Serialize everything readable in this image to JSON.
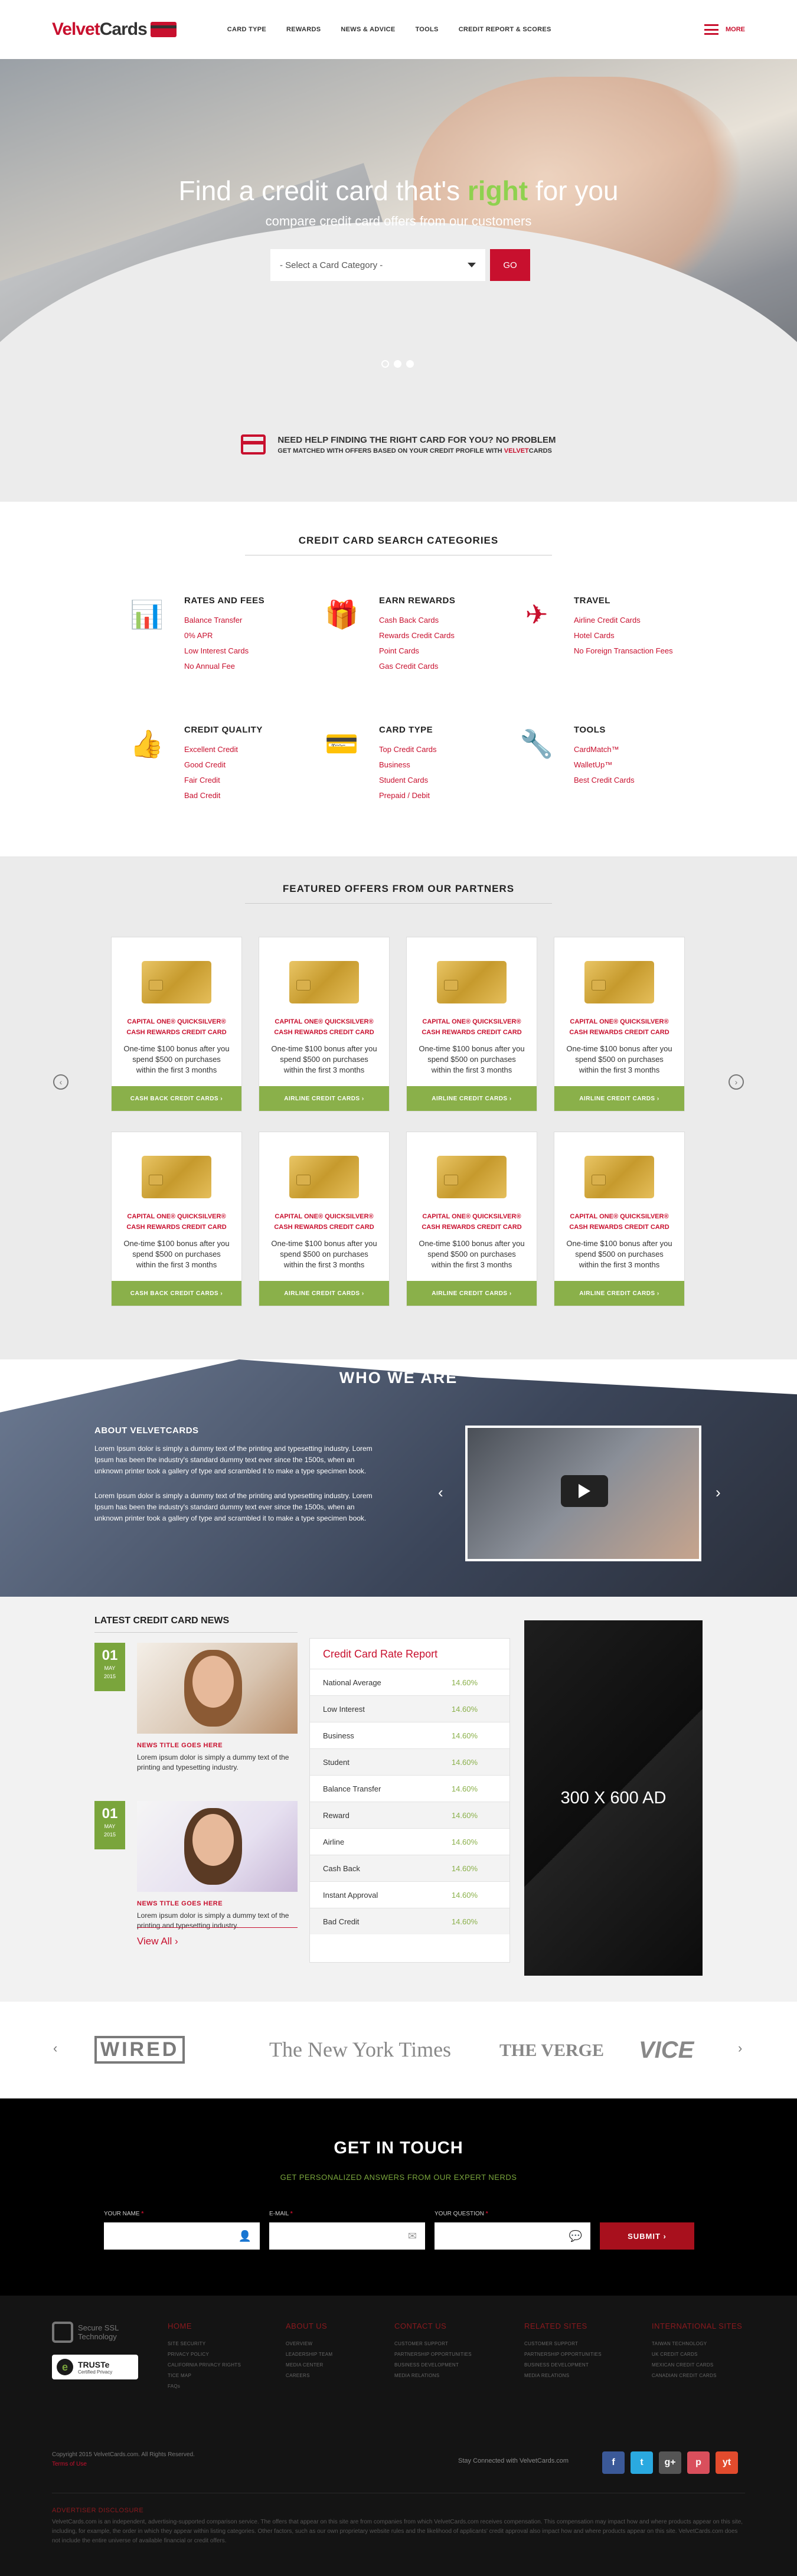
{
  "header": {
    "logo_part1": "Velvet",
    "logo_part2": "Cards",
    "nav": [
      "CARD TYPE",
      "REWARDS",
      "NEWS & ADVICE",
      "TOOLS",
      "CREDIT REPORT & SCORES"
    ],
    "more_label": "MORE"
  },
  "hero": {
    "title_before": "Find a credit card that's ",
    "title_highlight": "right",
    "title_after": " for you",
    "subtitle": "compare credit card offers from our customers",
    "select_placeholder": "- Select a Card Category -",
    "go_label": "GO"
  },
  "help": {
    "line1": "NEED HELP FINDING THE RIGHT CARD FOR YOU? NO PROBLEM",
    "line2": "GET MATCHED WITH OFFERS BASED ON YOUR CREDIT PROFILE WITH ",
    "brand_part1": "VELVET",
    "brand_part2": "CARDS"
  },
  "categories": {
    "title": "CREDIT CARD SEARCH CATEGORIES",
    "items": [
      {
        "icon": "bar-chart-icon",
        "title": "RATES AND FEES",
        "links": [
          "Balance Transfer",
          "0% APR",
          "Low Interest Cards",
          "No Annual Fee"
        ]
      },
      {
        "icon": "gift-icon",
        "title": "EARN REWARDS",
        "links": [
          "Cash Back Cards",
          "Rewards Credit Cards",
          "Point Cards",
          "Gas Credit Cards"
        ]
      },
      {
        "icon": "airplane-icon",
        "title": "TRAVEL",
        "links": [
          "Airline Credit Cards",
          "Hotel Cards",
          "No Foreign Transaction Fees"
        ]
      },
      {
        "icon": "thumbs-up-icon",
        "title": "CREDIT QUALITY",
        "links": [
          "Excellent Credit",
          "Good Credit",
          "Fair Credit",
          "Bad Credit"
        ]
      },
      {
        "icon": "credit-card-icon",
        "title": "CARD TYPE",
        "links": [
          "Top Credit Cards",
          "Business",
          "Student Cards",
          "Prepaid / Debit"
        ]
      },
      {
        "icon": "wrench-icon",
        "title": "TOOLS",
        "links": [
          "CardMatch™",
          "WalletUp™",
          "Best Credit Cards"
        ]
      }
    ]
  },
  "offers": {
    "title": "FEATURED OFFERS FROM OUR PARTNERS",
    "items": [
      {
        "name": "CAPITAL ONE® QUICKSILVER® CASH REWARDS CREDIT CARD",
        "desc": "One-time $100 bonus after you spend $500 on purchases within the first 3 months",
        "button": "CASH BACK CREDIT CARDS"
      },
      {
        "name": "CAPITAL ONE® QUICKSILVER® CASH REWARDS CREDIT CARD",
        "desc": "One-time $100 bonus after you spend $500 on purchases within the first 3 months",
        "button": "AIRLINE CREDIT CARDS"
      },
      {
        "name": "CAPITAL ONE® QUICKSILVER® CASH REWARDS CREDIT CARD",
        "desc": "One-time $100 bonus after you spend $500 on purchases within the first 3 months",
        "button": "AIRLINE CREDIT CARDS"
      },
      {
        "name": "CAPITAL ONE® QUICKSILVER® CASH REWARDS CREDIT CARD",
        "desc": "One-time $100 bonus after you spend $500 on purchases within the first 3 months",
        "button": "AIRLINE CREDIT CARDS"
      },
      {
        "name": "CAPITAL ONE® QUICKSILVER® CASH REWARDS CREDIT CARD",
        "desc": "One-time $100 bonus after you spend $500 on purchases within the first 3 months",
        "button": "CASH BACK CREDIT CARDS"
      },
      {
        "name": "CAPITAL ONE® QUICKSILVER® CASH REWARDS CREDIT CARD",
        "desc": "One-time $100 bonus after you spend $500 on purchases within the first 3 months",
        "button": "AIRLINE CREDIT CARDS"
      },
      {
        "name": "CAPITAL ONE® QUICKSILVER® CASH REWARDS CREDIT CARD",
        "desc": "One-time $100 bonus after you spend $500 on purchases within the first 3 months",
        "button": "AIRLINE CREDIT CARDS"
      },
      {
        "name": "CAPITAL ONE® QUICKSILVER® CASH REWARDS CREDIT CARD",
        "desc": "One-time $100 bonus after you spend $500 on purchases within the first 3 months",
        "button": "AIRLINE CREDIT CARDS"
      }
    ]
  },
  "who": {
    "title": "WHO WE ARE",
    "about_title": "ABOUT VELVETCARDS",
    "para1": "Lorem Ipsum dolor is simply a dummy text of the printing and typesetting industry. Lorem Ipsum has been the industry's standard dummy text ever since the 1500s, when an unknown printer took a gallery of type and scrambled it to make a type specimen book.",
    "para2": "Lorem Ipsum dolor is simply a dummy text of the printing and typesetting industry. Lorem Ipsum has been the industry's standard dummy text ever since the 1500s, when an unknown printer took a gallery of type and scrambled it to make a type specimen book."
  },
  "news": {
    "title": "LATEST CREDIT CARD NEWS",
    "items": [
      {
        "day": "01",
        "month": "MAY",
        "year": "2015",
        "title": "NEWS TITLE GOES HERE",
        "desc": "Lorem ipsum dolor is simply a dummy text of the printing and typesetting industry."
      },
      {
        "day": "01",
        "month": "MAY",
        "year": "2015",
        "title": "NEWS TITLE GOES HERE",
        "desc": "Lorem ipsum dolor is simply a dummy text of the printing and typesetting industry."
      }
    ],
    "view_all": "View All"
  },
  "rates": {
    "title": "Credit Card Rate Report",
    "rows": [
      {
        "label": "National Average",
        "value": "14.60%"
      },
      {
        "label": "Low Interest",
        "value": "14.60%"
      },
      {
        "label": "Business",
        "value": "14.60%"
      },
      {
        "label": "Student",
        "value": "14.60%"
      },
      {
        "label": "Balance Transfer",
        "value": "14.60%"
      },
      {
        "label": "Reward",
        "value": "14.60%"
      },
      {
        "label": "Airline",
        "value": "14.60%"
      },
      {
        "label": "Cash Back",
        "value": "14.60%"
      },
      {
        "label": "Instant Approval",
        "value": "14.60%"
      },
      {
        "label": "Bad Credit",
        "value": "14.60%"
      }
    ]
  },
  "ad": {
    "label": "300 X 600 AD"
  },
  "press": {
    "logos": [
      "WIRED",
      "The New York Times",
      "THE VERGE",
      "VICE"
    ]
  },
  "contact": {
    "title": "GET IN TOUCH",
    "subtitle": "GET PERSONALIZED ANSWERS FROM OUR EXPERT NERDS",
    "fields": [
      "YOUR NAME",
      "E-MAIL",
      "YOUR QUESTION"
    ],
    "required_mark": "*",
    "submit": "SUBMIT"
  },
  "footer": {
    "seal_text": "Secure SSL Technology",
    "truste_title": "TRUSTe",
    "truste_sub": "Certified Privacy",
    "columns": [
      {
        "title": "HOME",
        "links": [
          "SITE SECURITY",
          "PRIVACY POLICY",
          "CALIFORNIA PRIVACY RIGHTS",
          "TICE MAP",
          "FAQs"
        ]
      },
      {
        "title": "ABOUT US",
        "links": [
          "OVERVIEW",
          "LEADERSHIP TEAM",
          "MEDIA CENTER",
          "CAREERS"
        ]
      },
      {
        "title": "CONTACT US",
        "links": [
          "CUSTOMER SUPPORT",
          "PARTNERSHIP OPPORTUNITIES",
          "BUSINESS DEVELOPMENT",
          "MEDIA RELATIONS"
        ]
      },
      {
        "title": "RELATED SITES",
        "links": [
          "CUSTOMER SUPPORT",
          "PARTNERSHIP OPPORTUNITIES",
          "BUSINESS DEVELOPMENT",
          "MEDIA RELATIONS"
        ]
      },
      {
        "title": "INTERNATIONAL SITES",
        "links": [
          "TAIWAN TECHNOLOGY",
          "UK CREDIT CARDS",
          "MEXICAN CREDIT CARDS",
          "CANADIAN CREDIT CARDS"
        ]
      }
    ],
    "copyright": "Copyright 2015 VelvetCards.com. All Rights Reserved.",
    "terms": "Terms of Use",
    "stay": "Stay Connected with VelvetCards.com",
    "social": [
      "f",
      "t",
      "g+",
      "p",
      "yt"
    ],
    "ad_disclosure_title": "ADVERTISER DISCLOSURE",
    "ad_disclosure_text": "VelvetCards.com is an independent, advertising-supported comparison service. The offers that appear on this site are from companies from which VelvetCards.com receives compensation. This compensation may impact how and where products appear on this site, including, for example, the order in which they appear within listing categories. Other factors, such as our own proprietary website rules and the likelihood of applicants' credit approval also impact how and where products appear on this site. VelvetCards.com does not include the entire universe of available financial or credit offers."
  },
  "colors": {
    "brand_red": "#c8102e",
    "accent_green": "#8ab04a"
  }
}
